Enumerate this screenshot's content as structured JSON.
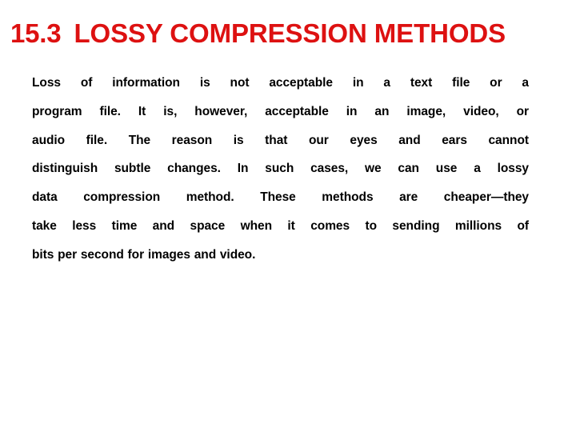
{
  "slide": {
    "background_color": "#ffffff",
    "title": {
      "number": "15.3",
      "text": "LOSSY COMPRESSION METHODS",
      "color": "#dd1111"
    },
    "body": {
      "color": "#000000",
      "alignment": "justify",
      "full_text": "Loss of information is not acceptable in a text file or a program file. It is, however, acceptable in an image, video, or audio file. The reason is that our eyes and ears cannot distinguish subtle changes. In such cases, we can use a lossy data compression method. These methods are cheaper—they take less time and space when it comes to sending millions of bits per second for images and video.",
      "lines": [
        "Loss of information is not acceptable in a text file or a",
        "program file. It is, however, acceptable in an image, video, or",
        "audio file. The reason is that our eyes and ears cannot",
        "distinguish subtle changes. In such cases, we can use a lossy",
        "data compression method. These methods are cheaper—they",
        "take less time and space when it comes to sending millions of",
        "bits per second for images and video."
      ]
    }
  }
}
